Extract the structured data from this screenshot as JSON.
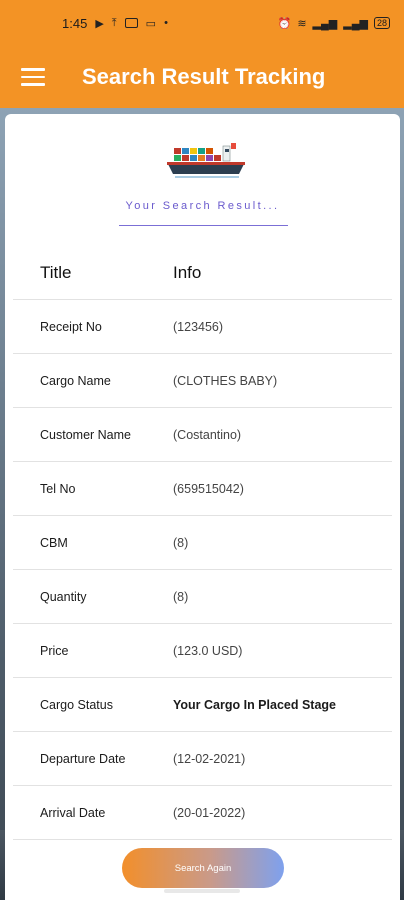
{
  "status_bar": {
    "time": "1:45",
    "dot": "•",
    "battery": "28"
  },
  "app_bar": {
    "title": "Search Result Tracking",
    "menu_icon": "hamburger-menu-icon"
  },
  "result_heading": "Your Search Result...",
  "table": {
    "headers": {
      "title": "Title",
      "info": "Info"
    },
    "rows": [
      {
        "title": "Receipt No",
        "info": "(123456)"
      },
      {
        "title": "Cargo Name",
        "info": "(CLOTHES BABY)"
      },
      {
        "title": "Customer Name",
        "info": "(Costantino)"
      },
      {
        "title": "Tel No",
        "info": "(659515042)"
      },
      {
        "title": "CBM",
        "info": "(8)"
      },
      {
        "title": "Quantity",
        "info": "(8)"
      },
      {
        "title": "Price",
        "info": "(123.0 USD)"
      },
      {
        "title": "Cargo Status",
        "info": "Your Cargo In Placed Stage"
      },
      {
        "title": "Departure Date",
        "info": "(12-02-2021)"
      },
      {
        "title": "Arrival Date",
        "info": "(20-01-2022)"
      }
    ]
  },
  "search_again_label": "Search Again",
  "colors": {
    "primary": "#f39325",
    "accent": "#6a5acd"
  }
}
